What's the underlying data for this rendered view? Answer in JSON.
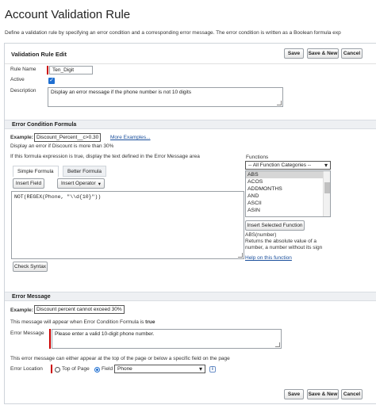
{
  "page": {
    "title": "Account Validation Rule",
    "description": "Define a validation rule by specifying an error condition and a corresponding error message. The error condition is written as a Boolean formula exp"
  },
  "edit": {
    "title": "Validation Rule Edit",
    "buttons": {
      "save": "Save",
      "save_new": "Save & New",
      "cancel": "Cancel"
    },
    "rule_name_label": "Rule Name",
    "rule_name_value": "Ten_Digit",
    "active_label": "Active",
    "active_checked": true,
    "description_label": "Description",
    "description_value": "Display an error message if the phone number is not 10 digits"
  },
  "condition": {
    "section_title": "Error Condition Formula",
    "example_label": "Example:",
    "example_value": "Discount_Percent__c>0.30",
    "more_examples": "More Examples...",
    "example_explain": "Display an error if Discount is more than 30%",
    "instruction": "If this formula expression is true, display the text defined in the Error Message area",
    "tabs": {
      "simple": "Simple Formula",
      "advanced": "Better Formula"
    },
    "insert_field": "Insert Field",
    "insert_operator": "Insert Operator",
    "formula": "NOT(REGEX(Phone, \"\\\\d{10}\"))",
    "check_syntax": "Check Syntax"
  },
  "functions": {
    "label": "Functions",
    "category": "-- All Function Categories --",
    "items": [
      "ABS",
      "ACOS",
      "ADDMONTHS",
      "AND",
      "ASCII",
      "ASIN"
    ],
    "selected": "ABS",
    "insert_button": "Insert Selected Function",
    "signature": "ABS(number)",
    "help_text": "Returns the absolute value of a number, a number without its sign",
    "help_link": "Help on this function"
  },
  "error": {
    "section_title": "Error Message",
    "example_label": "Example:",
    "example_value": "Discount percent cannot exceed 30%",
    "note_prefix": "This message will appear when Error Condition Formula is ",
    "note_bold": "true",
    "message_label": "Error Message",
    "message_value": "Please enter a valid 10-digit phone number.",
    "location_note": "This error message can either appear at the top of the page or below a specific field on the page",
    "location_label": "Error Location",
    "top_of_page": "Top of Page",
    "field_option": "Field",
    "field_value": "Phone",
    "info_glyph": "i"
  },
  "icons": {
    "checkmark": "✓",
    "dropdown": "▾"
  }
}
